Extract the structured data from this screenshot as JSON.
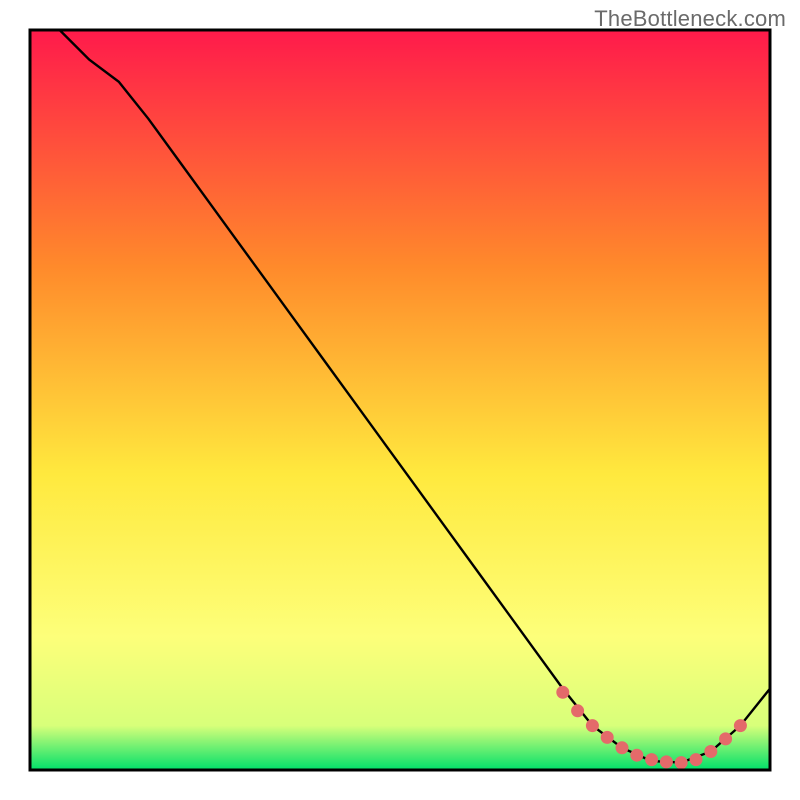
{
  "watermark": "TheBottleneck.com",
  "colors": {
    "gradient_top": "#ff1a4b",
    "gradient_mid1": "#ff8a2b",
    "gradient_mid2": "#ffe93e",
    "gradient_mid3": "#fdff7a",
    "gradient_bottom": "#00e06a",
    "line": "#000000",
    "markers": "#e46a6a",
    "frame": "#000000"
  },
  "chart_data": {
    "type": "line",
    "title": "",
    "xlabel": "",
    "ylabel": "",
    "xlim": [
      0,
      100
    ],
    "ylim": [
      0,
      100
    ],
    "series": [
      {
        "name": "curve",
        "x": [
          4,
          8,
          12,
          16,
          20,
          24,
          28,
          32,
          36,
          40,
          44,
          48,
          52,
          56,
          60,
          64,
          68,
          72,
          76,
          80,
          84,
          88,
          92,
          96,
          100
        ],
        "y": [
          100,
          96,
          93,
          88,
          82.5,
          77,
          71.5,
          66,
          60.5,
          55,
          49.5,
          44,
          38.5,
          33,
          27.5,
          22,
          16.5,
          11,
          6,
          3,
          1.2,
          1,
          2.5,
          6,
          11
        ],
        "markers_x": [
          72,
          74,
          76,
          78,
          80,
          82,
          84,
          86,
          88,
          90,
          92,
          94,
          96
        ],
        "markers_y": [
          10.5,
          8,
          6,
          4.4,
          3,
          2,
          1.4,
          1.1,
          1,
          1.4,
          2.5,
          4.2,
          6
        ]
      }
    ],
    "legend": null,
    "grid": false
  }
}
